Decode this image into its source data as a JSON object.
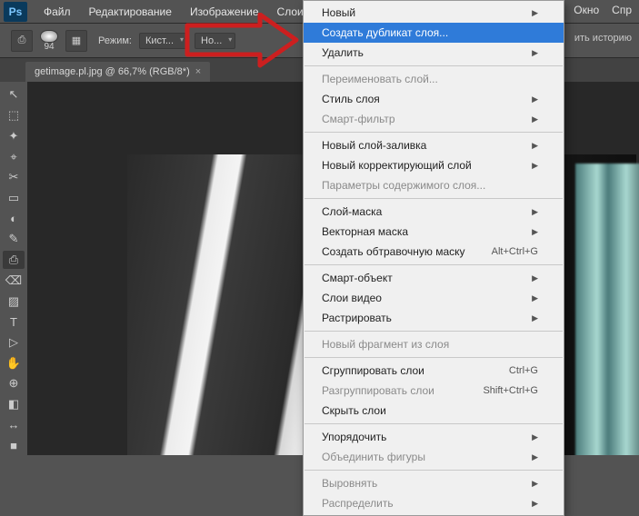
{
  "app": {
    "logo": "Ps"
  },
  "menubar": {
    "items": [
      "Файл",
      "Редактирование",
      "Изображение",
      "Слои"
    ],
    "right": [
      "Окно",
      "Спр"
    ]
  },
  "options": {
    "brush_size": "94",
    "mode_label": "Режим:",
    "mode_value": "Кист...",
    "blend_value": "Но...",
    "history_hint": "ить историю"
  },
  "tab": {
    "title": "getimage.pl.jpg @ 66,7% (RGB/8*)",
    "close": "×"
  },
  "tools": [
    "↖",
    "⬚",
    "✦",
    "⌖",
    "✂",
    "▭",
    "◐",
    "✎",
    "⎙",
    "⌫",
    "▨",
    "T",
    "▷",
    "✋",
    "⊕",
    "◧",
    "↔",
    "■"
  ],
  "menu": {
    "items": [
      {
        "label": "Новый",
        "sub": true
      },
      {
        "label": "Создать дубликат слоя...",
        "hl": true
      },
      {
        "label": "Удалить",
        "sub": true
      },
      {
        "sep": true
      },
      {
        "label": "Переименовать слой...",
        "disabled": true
      },
      {
        "label": "Стиль слоя",
        "sub": true
      },
      {
        "label": "Смарт-фильтр",
        "sub": true,
        "disabled": true
      },
      {
        "sep": true
      },
      {
        "label": "Новый слой-заливка",
        "sub": true
      },
      {
        "label": "Новый корректирующий слой",
        "sub": true
      },
      {
        "label": "Параметры содержимого слоя...",
        "disabled": true
      },
      {
        "sep": true
      },
      {
        "label": "Слой-маска",
        "sub": true
      },
      {
        "label": "Векторная маска",
        "sub": true
      },
      {
        "label": "Создать обтравочную маску",
        "kb": "Alt+Ctrl+G"
      },
      {
        "sep": true
      },
      {
        "label": "Смарт-объект",
        "sub": true
      },
      {
        "label": "Слои видео",
        "sub": true
      },
      {
        "label": "Растрировать",
        "sub": true
      },
      {
        "sep": true
      },
      {
        "label": "Новый фрагмент из слоя",
        "disabled": true
      },
      {
        "sep": true
      },
      {
        "label": "Сгруппировать слои",
        "kb": "Ctrl+G"
      },
      {
        "label": "Разгруппировать слои",
        "kb": "Shift+Ctrl+G",
        "disabled": true
      },
      {
        "label": "Скрыть слои"
      },
      {
        "sep": true
      },
      {
        "label": "Упорядочить",
        "sub": true
      },
      {
        "label": "Объединить фигуры",
        "sub": true,
        "disabled": true
      },
      {
        "sep": true
      },
      {
        "label": "Выровнять",
        "sub": true,
        "disabled": true
      },
      {
        "label": "Распределить",
        "sub": true,
        "disabled": true
      }
    ]
  }
}
